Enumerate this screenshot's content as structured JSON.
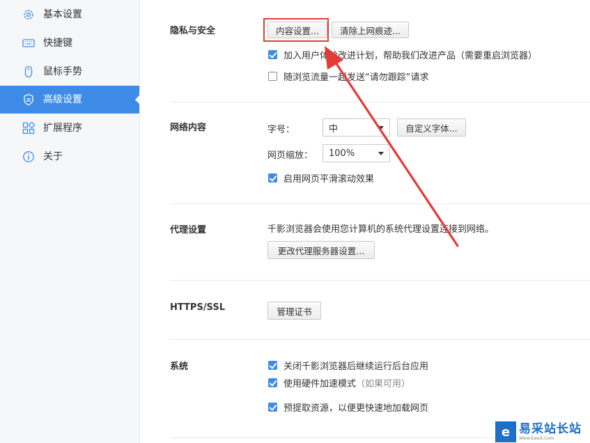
{
  "sidebar": {
    "items": [
      {
        "label": "基本设置",
        "icon": "gear-icon"
      },
      {
        "label": "快捷键",
        "icon": "keyboard-icon"
      },
      {
        "label": "鼠标手势",
        "icon": "mouse-icon"
      },
      {
        "label": "高级设置",
        "icon": "shield-icon",
        "active": true
      },
      {
        "label": "扩展程序",
        "icon": "extensions-icon"
      },
      {
        "label": "关于",
        "icon": "info-icon"
      }
    ]
  },
  "privacy": {
    "title": "隐私与安全",
    "content_settings_button": "内容设置...",
    "clear_history_button": "清除上网痕迹...",
    "ux_plan_label": "加入用户体验改进计划，帮助我们改进产品（需要重启浏览器）",
    "ux_plan_checked": true,
    "dnt_label": "随浏览流量一起发送“请勿跟踪”请求",
    "dnt_checked": false
  },
  "web_content": {
    "title": "网络内容",
    "font_size_label": "字号：",
    "font_size_value": "中",
    "custom_font_button": "自定义字体...",
    "zoom_label": "网页缩放：",
    "zoom_value": "100%",
    "smooth_scroll_label": "启用网页平滑滚动效果",
    "smooth_scroll_checked": true
  },
  "proxy": {
    "title": "代理设置",
    "description": "千影浏览器会使用您计算机的系统代理设置连接到网络。",
    "change_button": "更改代理服务器设置..."
  },
  "https": {
    "title": "HTTPS/SSL",
    "manage_certs_button": "管理证书"
  },
  "system": {
    "title": "系统",
    "background_run_label": "关闭千影浏览器后继续运行后台应用",
    "background_run_checked": true,
    "hw_accel_label": "使用硬件加速模式",
    "hw_accel_hint": "（如果可用）",
    "hw_accel_checked": true,
    "prefetch_label": "预提取资源，以便更快速地加载网页",
    "prefetch_checked": true
  },
  "watermark": {
    "logo_letter": "e",
    "title": "易采站长站",
    "subtitle": "Www.Easck.Com"
  },
  "colors": {
    "accent": "#3f8ce8",
    "annotation_red": "#e53935"
  }
}
